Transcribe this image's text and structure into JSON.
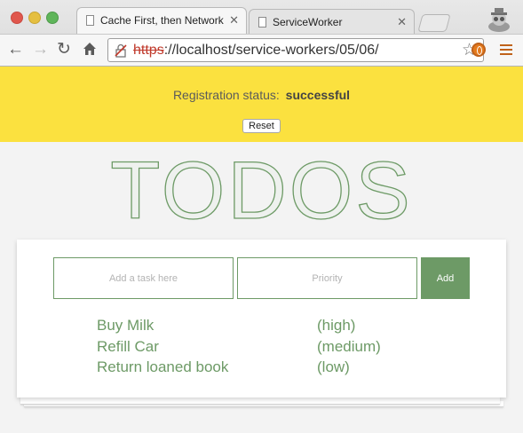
{
  "browser": {
    "tabs": [
      {
        "label": "Cache First, then Network",
        "active": true
      },
      {
        "label": "ServiceWorker",
        "active": false
      }
    ],
    "url": {
      "scheme": "https",
      "rest": "://localhost/service-workers/05/06/"
    }
  },
  "registration": {
    "label": "Registration status:",
    "value": "successful",
    "reset_label": "Reset"
  },
  "title": "TODOS",
  "form": {
    "task_placeholder": "Add a task here",
    "priority_placeholder": "Priority",
    "add_label": "Add"
  },
  "todos": [
    {
      "task": "Buy Milk",
      "priority": "(high)"
    },
    {
      "task": "Refill Car",
      "priority": "(medium)"
    },
    {
      "task": "Return loaned book",
      "priority": "(low)"
    }
  ],
  "colors": {
    "accent": "#6d9a66",
    "status_bar": "#fbe13f",
    "page_bg": "#f3f3f3"
  }
}
